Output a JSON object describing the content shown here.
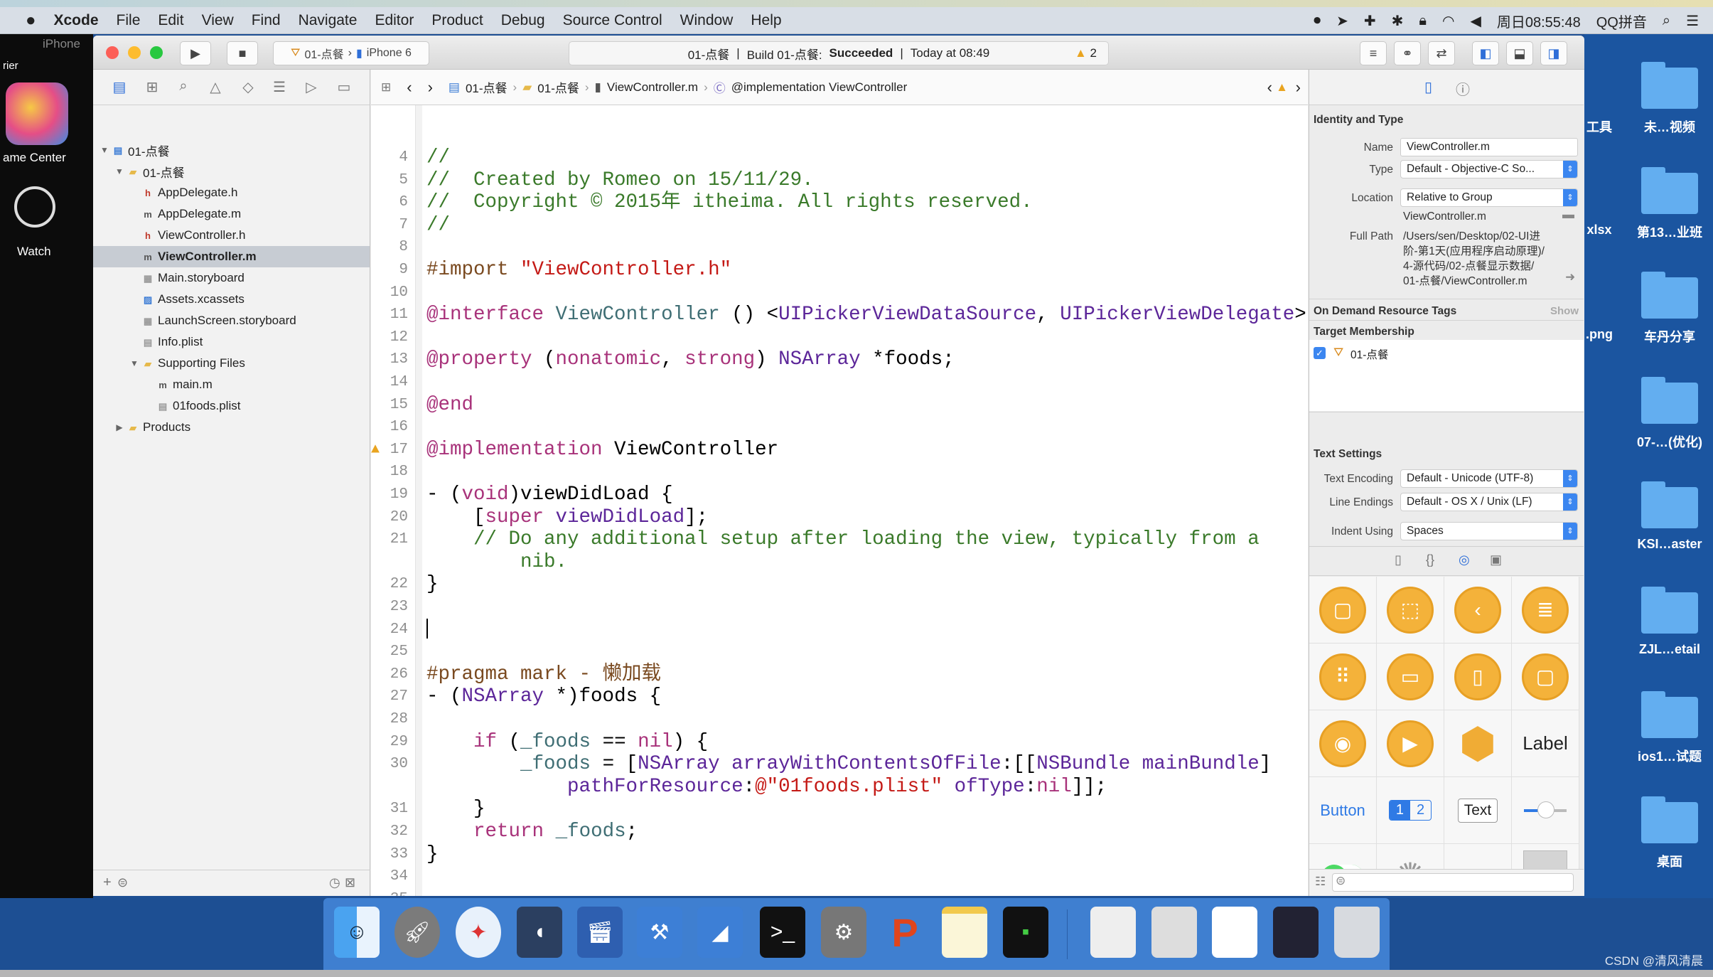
{
  "menubar": {
    "apple": "",
    "items": [
      "Xcode",
      "File",
      "Edit",
      "View",
      "Find",
      "Navigate",
      "Editor",
      "Product",
      "Debug",
      "Source Control",
      "Window",
      "Help"
    ],
    "clock": "周日08:55:48",
    "input_method": "QQ拼音"
  },
  "simulator": {
    "title": "iPhone",
    "carrier": "rier",
    "apps": [
      "ame Center",
      "Watch"
    ]
  },
  "toolbar": {
    "scheme": "01-点餐",
    "device": "iPhone 6",
    "activity_project": "01-点餐",
    "activity_build": "Build 01-点餐:",
    "activity_status": "Succeeded",
    "activity_time": "Today at 08:49",
    "warning_count": "2"
  },
  "jumpbar": {
    "items": [
      "01-点餐",
      "01-点餐",
      "ViewController.m",
      "@implementation ViewController"
    ]
  },
  "navigator": {
    "items": [
      {
        "label": "01-点餐",
        "level": 0,
        "kind": "project",
        "arrow": "▼"
      },
      {
        "label": "01-点餐",
        "level": 1,
        "kind": "folder",
        "arrow": "▼"
      },
      {
        "label": "AppDelegate.h",
        "level": 2,
        "kind": "h"
      },
      {
        "label": "AppDelegate.m",
        "level": 2,
        "kind": "m"
      },
      {
        "label": "ViewController.h",
        "level": 2,
        "kind": "h"
      },
      {
        "label": "ViewController.m",
        "level": 2,
        "kind": "m",
        "selected": true
      },
      {
        "label": "Main.storyboard",
        "level": 2,
        "kind": "storyboard"
      },
      {
        "label": "Assets.xcassets",
        "level": 2,
        "kind": "assets"
      },
      {
        "label": "LaunchScreen.storyboard",
        "level": 2,
        "kind": "storyboard"
      },
      {
        "label": "Info.plist",
        "level": 2,
        "kind": "plist"
      },
      {
        "label": "Supporting Files",
        "level": 2,
        "kind": "folder",
        "arrow": "▼"
      },
      {
        "label": "main.m",
        "level": 3,
        "kind": "m"
      },
      {
        "label": "01foods.plist",
        "level": 3,
        "kind": "plist"
      },
      {
        "label": "Products",
        "level": 1,
        "kind": "folder",
        "arrow": "▶"
      }
    ]
  },
  "editor": {
    "colors": {
      "comment": "#3a7a2a",
      "preprocessor": "#7a4a20",
      "string": "#c41a16",
      "keyword": "#a8327a",
      "type": "#5c2699",
      "project": "#3f6e74"
    },
    "warning_line": "17",
    "rows": [
      {
        "n": "4",
        "tokens": [
          {
            "t": "//",
            "k": "c"
          }
        ]
      },
      {
        "n": "5",
        "tokens": [
          {
            "t": "//  Created by Romeo on 15/11/29.",
            "k": "c"
          }
        ]
      },
      {
        "n": "6",
        "tokens": [
          {
            "t": "//  Copyright © 2015年 itheima. All rights reserved.",
            "k": "c"
          }
        ]
      },
      {
        "n": "7",
        "tokens": [
          {
            "t": "//",
            "k": "c"
          }
        ]
      },
      {
        "n": "8",
        "tokens": []
      },
      {
        "n": "9",
        "tokens": [
          {
            "t": "#import ",
            "k": "p"
          },
          {
            "t": "\"ViewController.h\"",
            "k": "s"
          }
        ]
      },
      {
        "n": "10",
        "tokens": []
      },
      {
        "n": "11",
        "tokens": [
          {
            "t": "@interface",
            "k": "k"
          },
          {
            "t": " ",
            "k": "n"
          },
          {
            "t": "ViewController",
            "k": "u"
          },
          {
            "t": " () <",
            "k": "n"
          },
          {
            "t": "UIPickerViewDataSource",
            "k": "t"
          },
          {
            "t": ", ",
            "k": "n"
          },
          {
            "t": "UIPickerViewDelegate",
            "k": "t"
          },
          {
            "t": ">",
            "k": "n"
          }
        ]
      },
      {
        "n": "12",
        "tokens": []
      },
      {
        "n": "13",
        "tokens": [
          {
            "t": "@property",
            "k": "k"
          },
          {
            "t": " (",
            "k": "n"
          },
          {
            "t": "nonatomic",
            "k": "k"
          },
          {
            "t": ", ",
            "k": "n"
          },
          {
            "t": "strong",
            "k": "k"
          },
          {
            "t": ") ",
            "k": "n"
          },
          {
            "t": "NSArray",
            "k": "t"
          },
          {
            "t": " *foods;",
            "k": "n"
          }
        ]
      },
      {
        "n": "14",
        "tokens": []
      },
      {
        "n": "15",
        "tokens": [
          {
            "t": "@end",
            "k": "k"
          }
        ]
      },
      {
        "n": "16",
        "tokens": []
      },
      {
        "n": "17",
        "tokens": [
          {
            "t": "@implementation",
            "k": "k"
          },
          {
            "t": " ViewController",
            "k": "n"
          }
        ]
      },
      {
        "n": "18",
        "tokens": []
      },
      {
        "n": "19",
        "tokens": [
          {
            "t": "- (",
            "k": "n"
          },
          {
            "t": "void",
            "k": "k"
          },
          {
            "t": ")viewDidLoad {",
            "k": "n"
          }
        ]
      },
      {
        "n": "20",
        "tokens": [
          {
            "t": "    [",
            "k": "n"
          },
          {
            "t": "super",
            "k": "k"
          },
          {
            "t": " ",
            "k": "n"
          },
          {
            "t": "viewDidLoad",
            "k": "t"
          },
          {
            "t": "];",
            "k": "n"
          }
        ]
      },
      {
        "n": "21",
        "tokens": [
          {
            "t": "    // Do any additional setup after loading the view, typically from a",
            "k": "c"
          }
        ]
      },
      {
        "n": "",
        "tokens": [
          {
            "t": "        nib.",
            "k": "c"
          }
        ]
      },
      {
        "n": "22",
        "tokens": [
          {
            "t": "}",
            "k": "n"
          }
        ]
      },
      {
        "n": "23",
        "tokens": []
      },
      {
        "n": "24",
        "tokens": [],
        "cursor": true
      },
      {
        "n": "25",
        "tokens": []
      },
      {
        "n": "26",
        "tokens": [
          {
            "t": "#pragma mark - 懒加载",
            "k": "p"
          }
        ]
      },
      {
        "n": "27",
        "tokens": [
          {
            "t": "- (",
            "k": "n"
          },
          {
            "t": "NSArray",
            "k": "t"
          },
          {
            "t": " *)foods {",
            "k": "n"
          }
        ]
      },
      {
        "n": "28",
        "tokens": []
      },
      {
        "n": "29",
        "tokens": [
          {
            "t": "    ",
            "k": "n"
          },
          {
            "t": "if",
            "k": "k"
          },
          {
            "t": " (",
            "k": "n"
          },
          {
            "t": "_foods",
            "k": "u"
          },
          {
            "t": " == ",
            "k": "n"
          },
          {
            "t": "nil",
            "k": "k"
          },
          {
            "t": ") {",
            "k": "n"
          }
        ]
      },
      {
        "n": "30",
        "tokens": [
          {
            "t": "        ",
            "k": "n"
          },
          {
            "t": "_foods",
            "k": "u"
          },
          {
            "t": " = [",
            "k": "n"
          },
          {
            "t": "NSArray",
            "k": "t"
          },
          {
            "t": " ",
            "k": "n"
          },
          {
            "t": "arrayWithContentsOfFile",
            "k": "t"
          },
          {
            "t": ":[[",
            "k": "n"
          },
          {
            "t": "NSBundle",
            "k": "t"
          },
          {
            "t": " ",
            "k": "n"
          },
          {
            "t": "mainBundle",
            "k": "t"
          },
          {
            "t": "]",
            "k": "n"
          }
        ]
      },
      {
        "n": "",
        "tokens": [
          {
            "t": "            ",
            "k": "n"
          },
          {
            "t": "pathForResource",
            "k": "t"
          },
          {
            "t": ":",
            "k": "n"
          },
          {
            "t": "@\"01foods.plist\"",
            "k": "s"
          },
          {
            "t": " ",
            "k": "n"
          },
          {
            "t": "ofType",
            "k": "t"
          },
          {
            "t": ":",
            "k": "n"
          },
          {
            "t": "nil",
            "k": "k"
          },
          {
            "t": "]];",
            "k": "n"
          }
        ]
      },
      {
        "n": "31",
        "tokens": [
          {
            "t": "    }",
            "k": "n"
          }
        ]
      },
      {
        "n": "32",
        "tokens": [
          {
            "t": "    ",
            "k": "n"
          },
          {
            "t": "return",
            "k": "k"
          },
          {
            "t": " ",
            "k": "n"
          },
          {
            "t": "_foods",
            "k": "u"
          },
          {
            "t": ";",
            "k": "n"
          }
        ]
      },
      {
        "n": "33",
        "tokens": [
          {
            "t": "}",
            "k": "n"
          }
        ]
      },
      {
        "n": "34",
        "tokens": []
      },
      {
        "n": "35",
        "tokens": []
      },
      {
        "n": "36",
        "tokens": []
      }
    ]
  },
  "inspector": {
    "identity_title": "Identity and Type",
    "name_label": "Name",
    "name_value": "ViewController.m",
    "type_label": "Type",
    "type_value": "Default - Objective-C So...",
    "location_label": "Location",
    "location_value": "Relative to Group",
    "location_file": "ViewController.m",
    "fullpath_label": "Full Path",
    "fullpath_lines": [
      "/Users/sen/Desktop/02-UI进",
      "阶-第1天(应用程序启动原理)/",
      "4-源代码/02-点餐显示数据/",
      "01-点餐/ViewController.m"
    ],
    "odr_title": "On Demand Resource Tags",
    "odr_show": "Show",
    "target_title": "Target Membership",
    "target_name": "01-点餐",
    "target_checked": true,
    "text_title": "Text Settings",
    "encoding_label": "Text Encoding",
    "encoding_value": "Default - Unicode (UTF-8)",
    "endings_label": "Line Endings",
    "endings_value": "Default - OS X / Unix (LF)",
    "indent_label": "Indent Using",
    "indent_value": "Spaces",
    "library": [
      {
        "name": "view-controller",
        "glyph": "▢"
      },
      {
        "name": "storyboard-reference",
        "glyph": "⬚"
      },
      {
        "name": "navigation-controller",
        "glyph": "‹"
      },
      {
        "name": "table-view-controller",
        "glyph": "≣"
      },
      {
        "name": "collection-view-controller",
        "glyph": "⠿"
      },
      {
        "name": "tab-bar-controller",
        "glyph": "▭"
      },
      {
        "name": "page-view-controller",
        "glyph": "▯"
      },
      {
        "name": "glkit-view-controller",
        "glyph": "▢"
      },
      {
        "name": "object",
        "glyph": "◉"
      },
      {
        "name": "av-player-view-controller",
        "glyph": "▶"
      },
      {
        "name": "object-cube",
        "glyph": "⬢"
      },
      {
        "name": "label",
        "text": "Label"
      },
      {
        "name": "button",
        "text": "Button"
      },
      {
        "name": "segmented-control",
        "segments": [
          "1",
          "2"
        ]
      },
      {
        "name": "text-field",
        "text": "Text"
      },
      {
        "name": "slider"
      },
      {
        "name": "switch"
      },
      {
        "name": "activity-indicator",
        "glyph": "✺"
      },
      {
        "name": "progress-view"
      },
      {
        "name": "page-control"
      }
    ]
  },
  "desktop": {
    "items": [
      "工具",
      "未…视频",
      "xlsx",
      "第13…业班",
      ".png",
      "车丹分享",
      "07-…(优化)",
      "KSI…aster",
      "ZJL…etail",
      "ios1…试题",
      "桌面"
    ]
  },
  "dock": {
    "apps": [
      "finder",
      "launchpad",
      "safari",
      "mouse",
      "photo-slideshow",
      "xcode",
      "instruments",
      "terminal",
      "system-preferences",
      "p-app",
      "notes",
      "console",
      "window-1",
      "window-2",
      "window-3",
      "window-4",
      "trash"
    ]
  },
  "watermark": "CSDN @清风清晨"
}
